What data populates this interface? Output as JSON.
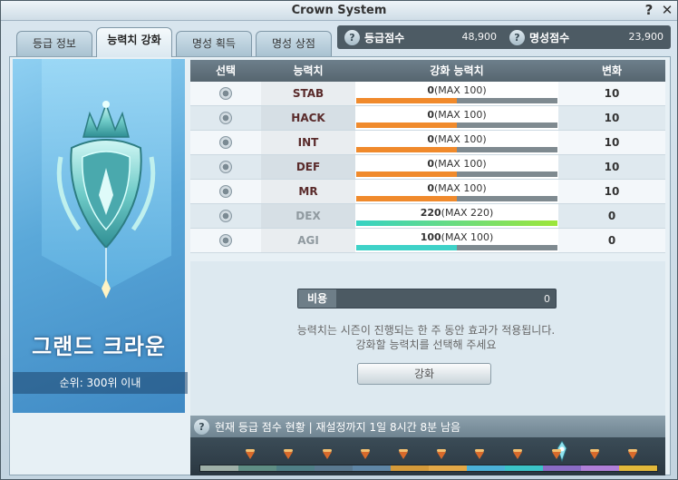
{
  "window": {
    "title": "Crown System",
    "help": "?",
    "close": "✕"
  },
  "tabs": [
    {
      "label": "등급 정보",
      "active": false
    },
    {
      "label": "능력치 강화",
      "active": true
    },
    {
      "label": "명성 획득",
      "active": false
    },
    {
      "label": "명성 상점",
      "active": false
    }
  ],
  "scores": {
    "grade": {
      "icon": "?",
      "label": "등급점수",
      "value": "48,900"
    },
    "fame": {
      "icon": "?",
      "label": "명성점수",
      "value": "23,900"
    }
  },
  "rank": {
    "name": "그랜드 크라운",
    "sub": "순위: 300위 이내"
  },
  "table": {
    "headers": {
      "select": "선택",
      "stat": "능력치",
      "power": "강화 능력치",
      "change": "변화"
    },
    "rows": [
      {
        "name": "STAB",
        "value": "0",
        "max": "(MAX 100)",
        "change": "10",
        "fill": 0.5,
        "color": "#f08a2c",
        "muted": false
      },
      {
        "name": "HACK",
        "value": "0",
        "max": "(MAX 100)",
        "change": "10",
        "fill": 0.5,
        "color": "#f08a2c",
        "muted": false
      },
      {
        "name": "INT",
        "value": "0",
        "max": "(MAX 100)",
        "change": "10",
        "fill": 0.5,
        "color": "#f08a2c",
        "muted": false
      },
      {
        "name": "DEF",
        "value": "0",
        "max": "(MAX 100)",
        "change": "10",
        "fill": 0.5,
        "color": "#f08a2c",
        "muted": false
      },
      {
        "name": "MR",
        "value": "0",
        "max": "(MAX 100)",
        "change": "10",
        "fill": 0.5,
        "color": "#f08a2c",
        "muted": false
      },
      {
        "name": "DEX",
        "value": "220",
        "max": "(MAX 220)",
        "change": "0",
        "fill": 1.0,
        "color": "#4fd2a0",
        "muted": true
      },
      {
        "name": "AGI",
        "value": "100",
        "max": "(MAX 100)",
        "change": "0",
        "fill": 0.5,
        "color": "#3fd2c8",
        "muted": true
      }
    ]
  },
  "cost": {
    "label": "비용",
    "value": "0"
  },
  "notice": {
    "line1": "능력치는 시즌이 진행되는 한 주 동안 효과가 적용됩니다.",
    "line2": "강화할 능력치를 선택해 주세요"
  },
  "upgrade_button": "강화",
  "status": {
    "icon": "?",
    "text": "현재 등급 점수 현황 | 재설정까지 1일 8시간 8분 남음"
  },
  "track": {
    "segments": [
      "#9fb0a8",
      "#5f8e84",
      "#4f7f86",
      "#5a7990",
      "#5f86a6",
      "#d49a3a",
      "#e3a847",
      "#4bb1d8",
      "#3bc3c8",
      "#8a6cc5",
      "#b07fd8",
      "#e2b83a"
    ],
    "current_level": 0.79
  }
}
